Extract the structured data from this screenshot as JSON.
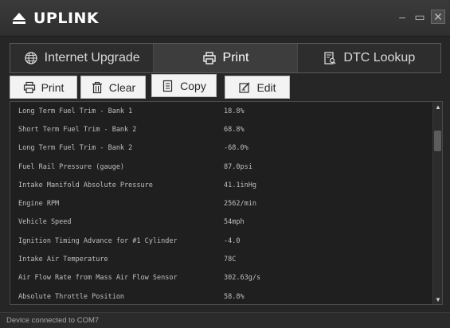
{
  "app": {
    "title": "UPLINK"
  },
  "window_controls": {
    "minimize": "–",
    "maximize": "▭",
    "close": "✕"
  },
  "tabs": [
    {
      "label": "Internet Upgrade",
      "icon": "globe-icon",
      "active": false
    },
    {
      "label": "Print",
      "icon": "printer-icon",
      "active": true
    },
    {
      "label": "DTC Lookup",
      "icon": "search-document-icon",
      "active": false
    }
  ],
  "toolbar": {
    "print_label": "Print",
    "clear_label": "Clear",
    "copy_label": "Copy",
    "edit_label": "Edit"
  },
  "rows": [
    {
      "name": "Long Term Fuel Trim - Bank 1",
      "value": "18.8%"
    },
    {
      "name": "Short Term Fuel Trim - Bank 2",
      "value": "68.8%"
    },
    {
      "name": "Long Term Fuel Trim - Bank 2",
      "value": "-68.0%"
    },
    {
      "name": "Fuel Rail Pressure (gauge)",
      "value": "87.0psi"
    },
    {
      "name": "Intake Manifold Absolute Pressure",
      "value": "41.1inHg"
    },
    {
      "name": "Engine RPM",
      "value": "2562/min"
    },
    {
      "name": "Vehicle Speed",
      "value": "54mph"
    },
    {
      "name": "Ignition Timing Advance for #1 Cylinder",
      "value": "-4.0"
    },
    {
      "name": "Intake Air Temperature",
      "value": "78C"
    },
    {
      "name": "Air Flow Rate from Mass Air Flow Sensor",
      "value": "302.63g/s"
    },
    {
      "name": "Absolute Throttle Position",
      "value": "58.8%"
    }
  ],
  "status": {
    "text": "Device connected to COM7"
  }
}
